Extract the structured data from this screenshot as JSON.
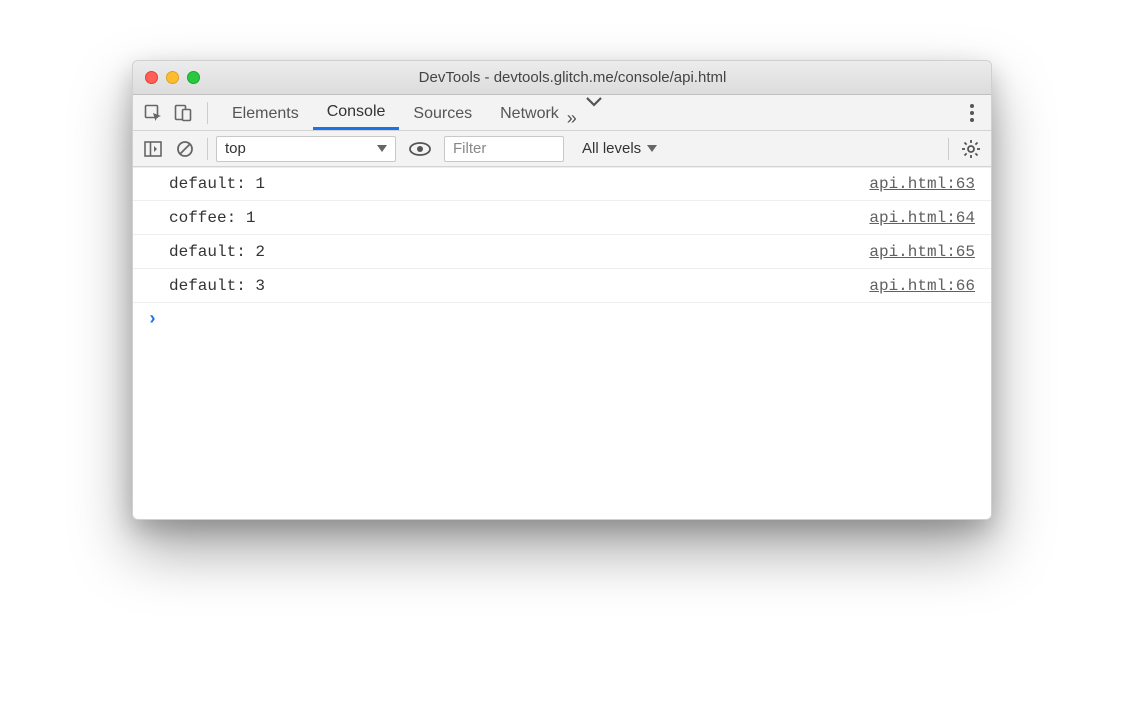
{
  "window": {
    "title": "DevTools - devtools.glitch.me/console/api.html"
  },
  "tabs": {
    "items": [
      "Elements",
      "Console",
      "Sources",
      "Network"
    ],
    "active": "Console"
  },
  "filterbar": {
    "context": "top",
    "filter_placeholder": "Filter",
    "levels": "All levels"
  },
  "console": {
    "rows": [
      {
        "msg": "default: 1",
        "src": "api.html:63"
      },
      {
        "msg": "coffee: 1",
        "src": "api.html:64"
      },
      {
        "msg": "default: 2",
        "src": "api.html:65"
      },
      {
        "msg": "default: 3",
        "src": "api.html:66"
      }
    ],
    "prompt": ""
  }
}
